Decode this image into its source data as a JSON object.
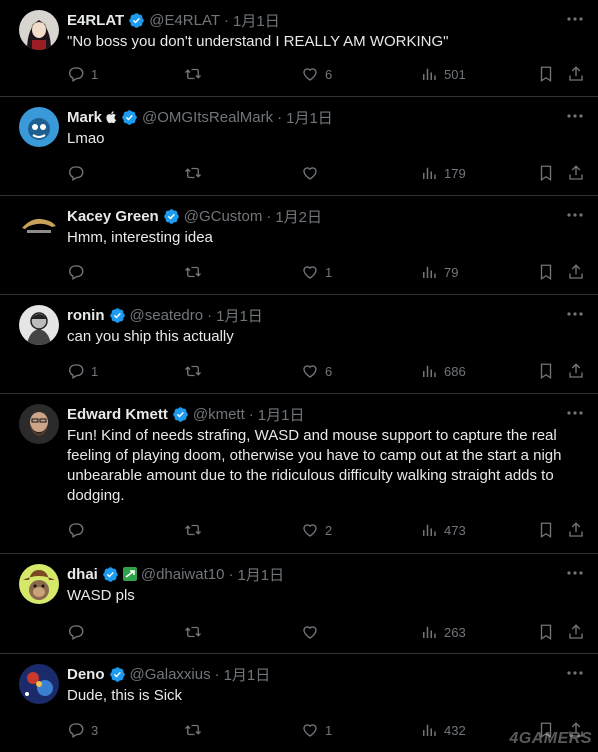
{
  "watermark": "4GAMERS",
  "tweets": [
    {
      "avatar_icon": "anime-girl-avatar",
      "name": "E4RLAT",
      "handle": "@E4RLAT",
      "date": "1月1日",
      "text": "\"No boss you don't understand I REALLY AM WORKING\"",
      "replies": "1",
      "retweets": "",
      "likes": "6",
      "views": "501"
    },
    {
      "avatar_icon": "blue-cartoon-avatar",
      "name": "Mark",
      "handle": "@OMGItsRealMark",
      "date": "1月1日",
      "text": "Lmao",
      "replies": "",
      "retweets": "",
      "likes": "",
      "views": "179"
    },
    {
      "avatar_icon": "kacey-logo-avatar",
      "name": "Kacey Green",
      "handle": "@GCustom",
      "date": "1月2日",
      "text": "Hmm, interesting idea",
      "replies": "",
      "retweets": "",
      "likes": "1",
      "views": "79"
    },
    {
      "avatar_icon": "sketch-portrait-avatar",
      "name": "ronin",
      "handle": "@seatedro",
      "date": "1月1日",
      "text": "can you ship this actually",
      "replies": "1",
      "retweets": "",
      "likes": "6",
      "views": "686"
    },
    {
      "avatar_icon": "bearded-man-avatar",
      "name": "Edward Kmett",
      "handle": "@kmett",
      "date": "1月1日",
      "text": "Fun! Kind of needs strafing, WASD and mouse support to capture the real feeling of playing doom, otherwise you have to camp out at the start a nigh unbearable amount due to the ridiculous difficulty walking straight adds to dodging.",
      "replies": "",
      "retweets": "",
      "likes": "2",
      "views": "473"
    },
    {
      "avatar_icon": "cowboy-ape-avatar",
      "name": "dhai",
      "handle": "@dhaiwat10",
      "date": "1月1日",
      "text": "WASD pls",
      "replies": "",
      "retweets": "",
      "likes": "",
      "views": "263"
    },
    {
      "avatar_icon": "galaxy-art-avatar",
      "name": "Deno",
      "handle": "@Galaxxius",
      "date": "1月1日",
      "text": "Dude, this is Sick",
      "replies": "3",
      "retweets": "",
      "likes": "1",
      "views": "432"
    }
  ]
}
